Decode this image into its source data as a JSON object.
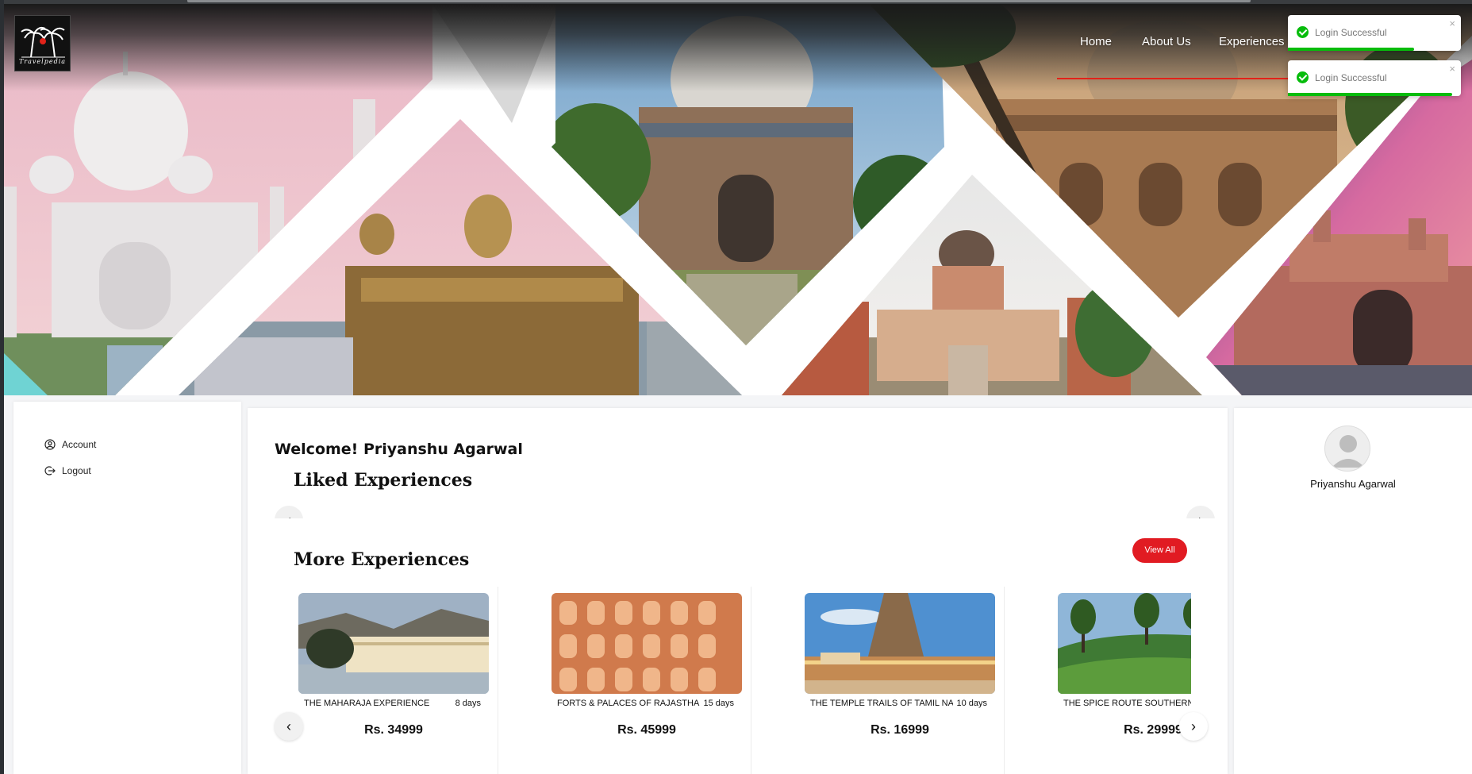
{
  "brand": {
    "logo_text": "Travelpedia"
  },
  "nav": {
    "items": [
      {
        "label": "Home"
      },
      {
        "label": "About Us"
      },
      {
        "label": "Experiences"
      }
    ],
    "accent_color": "#e2231a"
  },
  "toasts": [
    {
      "message": "Login Successful",
      "status": "success",
      "color": "#07bc0c",
      "progress": 0.73
    },
    {
      "message": "Login Successful",
      "status": "success",
      "color": "#07bc0c",
      "progress": 0.95
    }
  ],
  "sidebar": {
    "items": [
      {
        "label": "Account",
        "icon": "account-circle-icon"
      },
      {
        "label": "Logout",
        "icon": "logout-icon"
      }
    ]
  },
  "main": {
    "welcome": "Welcome! Priyanshu Agarwal",
    "liked_title": "Liked Experiences",
    "more_title": "More Experiences",
    "view_all_label": "View All",
    "cards": [
      {
        "name": "THE MAHARAJA EXPERIENCE",
        "days": "8 days",
        "price": "Rs. 34999"
      },
      {
        "name": "FORTS & PALACES OF RAJASTHAN",
        "days": "15 days",
        "price": "Rs. 45999"
      },
      {
        "name": "THE TEMPLE TRAILS OF TAMIL NADU",
        "days": "10 days",
        "price": "Rs. 16999"
      },
      {
        "name": "THE SPICE ROUTE SOUTHERN INDIA",
        "days": "",
        "price": "Rs. 29999"
      }
    ]
  },
  "profile": {
    "name": "Priyanshu Agarwal"
  },
  "colors": {
    "primary_button": "#e11b22",
    "success": "#07bc0c"
  }
}
